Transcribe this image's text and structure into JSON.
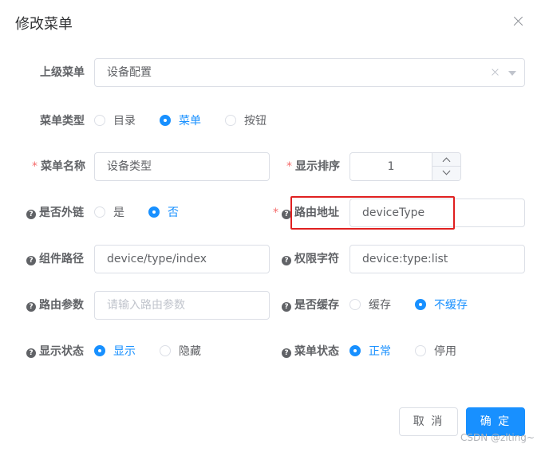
{
  "dialog": {
    "title": "修改菜单"
  },
  "colors": {
    "primary": "#1890ff",
    "required": "#f56c6c",
    "highlight": "#e02020",
    "border": "#dcdfe6"
  },
  "fields": {
    "parent_menu": {
      "label": "上级菜单",
      "value": "设备配置"
    },
    "menu_type": {
      "label": "菜单类型",
      "options": [
        "目录",
        "菜单",
        "按钮"
      ],
      "selected": "菜单"
    },
    "menu_name": {
      "required": "*",
      "label": "菜单名称",
      "value": "设备类型"
    },
    "sort_order": {
      "required": "*",
      "label": "显示排序",
      "value": "1"
    },
    "is_external": {
      "label": "是否外链",
      "options": [
        "是",
        "否"
      ],
      "selected": "否"
    },
    "route_path": {
      "required": "*",
      "label": "路由地址",
      "value": "deviceType"
    },
    "component_path": {
      "label": "组件路径",
      "value": "device/type/index"
    },
    "permission": {
      "label": "权限字符",
      "value": "device:type:list"
    },
    "route_params": {
      "label": "路由参数",
      "placeholder": "请输入路由参数"
    },
    "is_cache": {
      "label": "是否缓存",
      "options": [
        "缓存",
        "不缓存"
      ],
      "selected": "不缓存"
    },
    "visible": {
      "label": "显示状态",
      "options": [
        "显示",
        "隐藏"
      ],
      "selected": "显示"
    },
    "status": {
      "label": "菜单状态",
      "options": [
        "正常",
        "停用"
      ],
      "selected": "正常"
    }
  },
  "icons": {
    "help": "question-circle-icon",
    "close": "close-icon",
    "clear": "clear-icon",
    "arrow": "caret-down-icon",
    "up": "chevron-up-icon",
    "down": "chevron-down-icon"
  },
  "footer": {
    "cancel_label": "取 消",
    "confirm_label": "确 定"
  },
  "watermark": "CSDN @zlting~"
}
